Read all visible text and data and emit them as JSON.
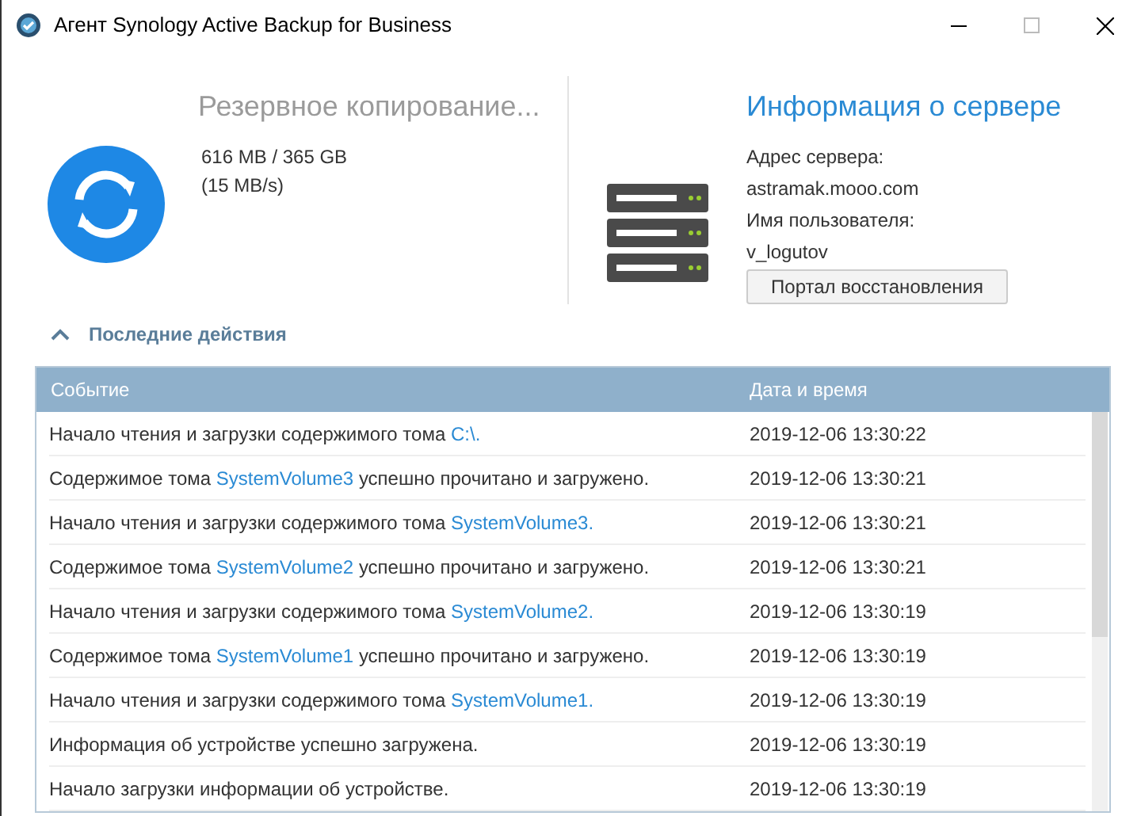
{
  "window": {
    "title": "Агент Synology Active Backup for Business"
  },
  "backup": {
    "status": "Резервное копирование...",
    "transferred": "616 MB / 365 GB",
    "speed": "(15 MB/s)"
  },
  "server": {
    "title": "Информация о сервере",
    "address_label": "Адрес сервера:",
    "address": "astramak.mooo.com",
    "user_label": "Имя пользователя:",
    "user": "v_logutov",
    "portal_button": "Портал восстановления"
  },
  "recent": {
    "title": "Последние действия",
    "expanded": true
  },
  "table": {
    "columns": [
      "Событие",
      "Дата и время"
    ],
    "rows": [
      {
        "event": {
          "text": "Начало чтения и загрузки содержимого тома ",
          "link": "C:\\."
        },
        "time": "2019-12-06 13:30:22"
      },
      {
        "event": {
          "text": "Содержимое тома ",
          "link": "SystemVolume3",
          "after": " успешно прочитано и загружено."
        },
        "time": "2019-12-06 13:30:21"
      },
      {
        "event": {
          "text": "Начало чтения и загрузки содержимого тома ",
          "link": "SystemVolume3."
        },
        "time": "2019-12-06 13:30:21"
      },
      {
        "event": {
          "text": "Содержимое тома ",
          "link": "SystemVolume2",
          "after": " успешно прочитано и загружено."
        },
        "time": "2019-12-06 13:30:21"
      },
      {
        "event": {
          "text": "Начало чтения и загрузки содержимого тома ",
          "link": "SystemVolume2."
        },
        "time": "2019-12-06 13:30:19"
      },
      {
        "event": {
          "text": "Содержимое тома ",
          "link": "SystemVolume1",
          "after": " успешно прочитано и загружено."
        },
        "time": "2019-12-06 13:30:19"
      },
      {
        "event": {
          "text": "Начало чтения и загрузки содержимого тома ",
          "link": "SystemVolume1."
        },
        "time": "2019-12-06 13:30:19"
      },
      {
        "event": {
          "text": "Информация об устройстве успешно загружена."
        },
        "time": "2019-12-06 13:30:19"
      },
      {
        "event": {
          "text": "Начало загрузки информации об устройстве."
        },
        "time": "2019-12-06 13:30:19"
      }
    ]
  }
}
